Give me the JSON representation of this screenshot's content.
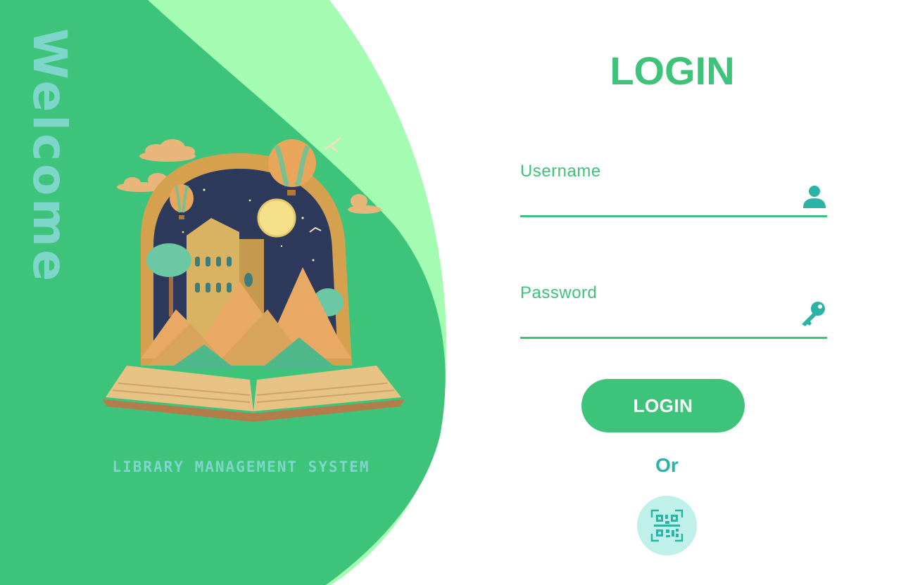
{
  "left_panel": {
    "welcome_text": "Welcome",
    "system_name": "LIBRARY MANAGEMENT SYSTEM"
  },
  "login_form": {
    "title": "LOGIN",
    "username": {
      "label": "Username",
      "value": "",
      "icon": "user-icon"
    },
    "password": {
      "label": "Password",
      "value": "",
      "icon": "key-icon"
    },
    "submit_label": "LOGIN",
    "or_text": "Or",
    "qr_icon": "qr-code-scan-icon"
  },
  "colors": {
    "primary_green": "#3dc47a",
    "light_green": "#a4fbb2",
    "teal_text": "#7dd6c9",
    "icon_teal": "#2bb3a6",
    "qr_circle": "#bff0ea"
  }
}
